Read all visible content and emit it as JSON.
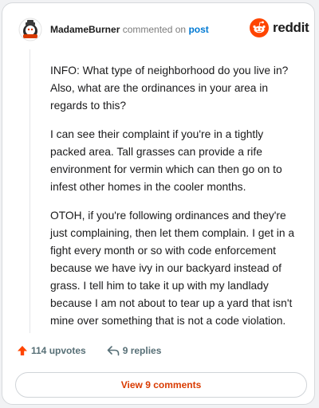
{
  "comment": {
    "username": "MadameBurner",
    "action_text": "commented on",
    "post_link": "post",
    "paragraphs": [
      "INFO: What type of neighborhood do you live in? Also, what are the ordinances in your area in regards to this?",
      "I can see their complaint if you're in a tightly packed area. Tall grasses can provide a rife environment for vermin which can then go on to infest other homes in the cooler months.",
      "OTOH, if you're following ordinances and they're just complaining, then let them complain. I get in a fight every month or so with code enforcement because we have ivy in our backyard instead of grass. I tell him to take it up with my landlady because I am not about to tear up a yard that isn't mine over something that is not a code violation."
    ],
    "upvotes": "114 upvotes",
    "replies": "9 replies",
    "view_button": "View 9 comments"
  },
  "brand": {
    "name": "reddit",
    "color": "#ff4500"
  },
  "icons": {
    "avatar": "snoo-avatar-icon",
    "logo": "reddit-logo-icon",
    "upvote": "upvote-arrow-icon",
    "reply": "reply-arrow-icon"
  }
}
